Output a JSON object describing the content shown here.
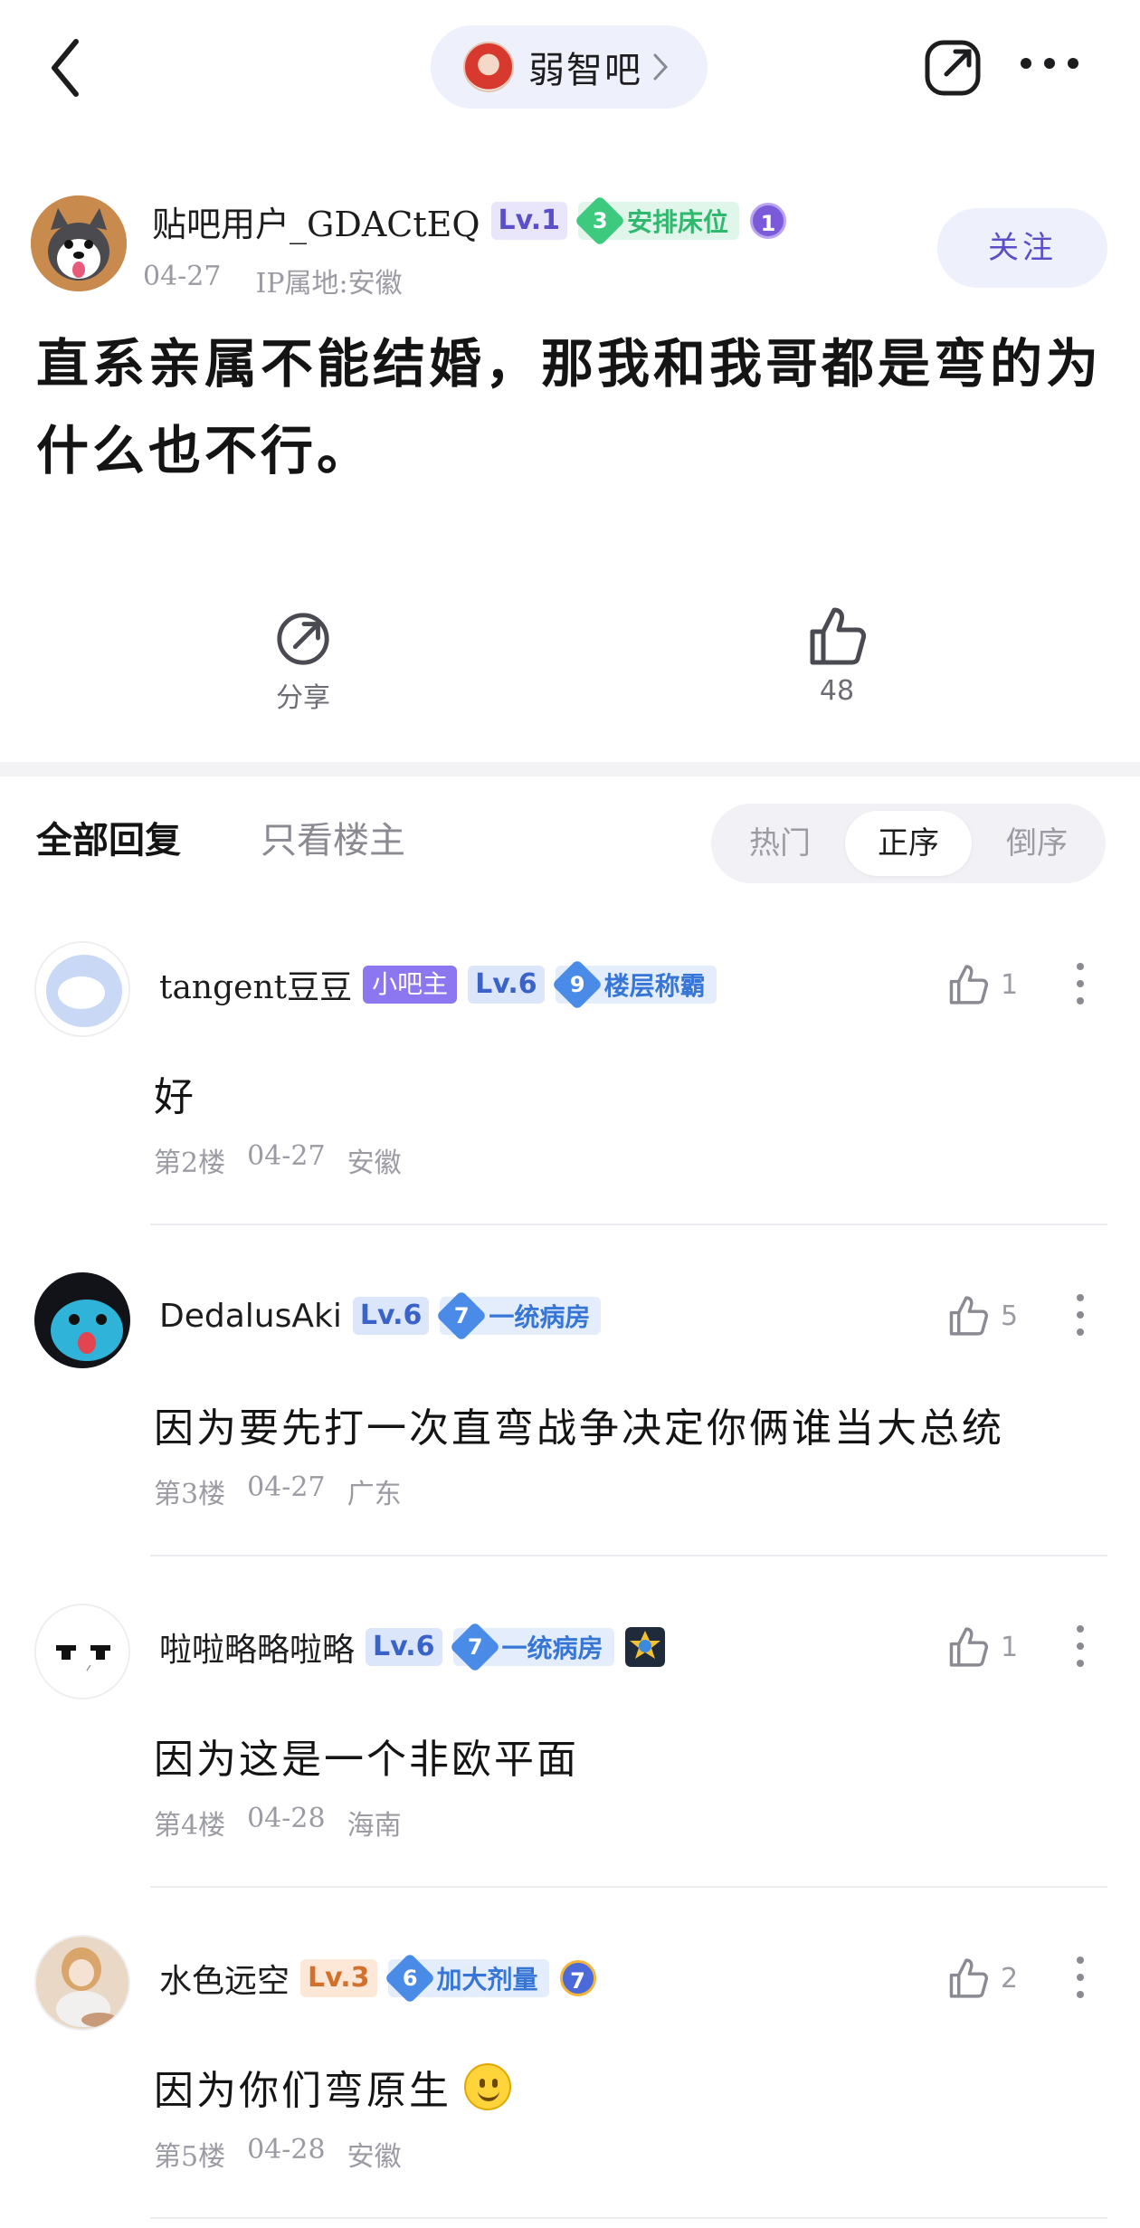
{
  "nav": {
    "forum_name": "弱智吧"
  },
  "author": {
    "name": "贴吧用户_GDACtEQ",
    "level": "Lv.1",
    "rank_num": "3",
    "rank_title": "安排床位",
    "medal": "1",
    "date": "04-27",
    "ip": "IP属地:安徽",
    "follow_label": "关注"
  },
  "post": {
    "title": "直系亲属不能结婚，那我和我哥都是弯的为什么也不行。",
    "share_label": "分享",
    "like_count": "48"
  },
  "tabs": {
    "all": "全部回复",
    "host_only": "只看楼主",
    "sort": [
      "热门",
      "正序",
      "倒序"
    ]
  },
  "replies": [
    {
      "name": "tangent豆豆",
      "host_badge": "小吧主",
      "level": "Lv.6",
      "rank_num": "9",
      "rank_title": "楼层称霸",
      "likes": "1",
      "text": "好",
      "floor": "第2楼",
      "date": "04-27",
      "location": "安徽"
    },
    {
      "name": "DedalusAki",
      "level": "Lv.6",
      "rank_num": "7",
      "rank_title": "一统病房",
      "likes": "5",
      "text": "因为要先打一次直弯战争决定你俩谁当大总统",
      "floor": "第3楼",
      "date": "04-27",
      "location": "广东"
    },
    {
      "name": "啦啦略略啦略",
      "level": "Lv.6",
      "rank_num": "7",
      "rank_title": "一统病房",
      "likes": "1",
      "text": "因为这是一个非欧平面",
      "floor": "第4楼",
      "date": "04-28",
      "location": "海南"
    },
    {
      "name": "水色远空",
      "level": "Lv.3",
      "rank_num": "6",
      "rank_title": "加大剂量",
      "medal": "7",
      "likes": "2",
      "text": "因为你们弯原生",
      "floor": "第5楼",
      "date": "04-28",
      "location": "安徽"
    }
  ]
}
